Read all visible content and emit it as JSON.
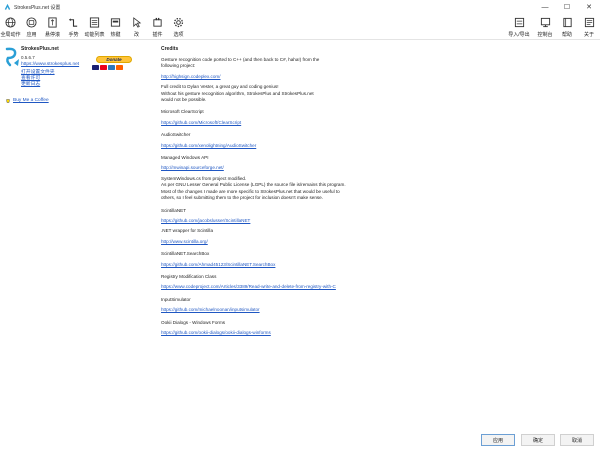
{
  "window": {
    "title": "StrokesPlus.net 设置",
    "min": "—",
    "max": "☐",
    "close": "✕"
  },
  "toolbar": {
    "left": [
      {
        "name": "global-actions",
        "label": "全局动作",
        "icon": "globe-icon"
      },
      {
        "name": "apps",
        "label": "应用",
        "icon": "app-window-icon"
      },
      {
        "name": "hover-scroll",
        "label": "悬停滚",
        "icon": "hover-scroll-icon"
      },
      {
        "name": "gestures",
        "label": "手势",
        "icon": "gesture-icon"
      },
      {
        "name": "gesture-list",
        "label": "动能列表",
        "icon": "list-icon"
      },
      {
        "name": "hotkeys",
        "label": "热键",
        "icon": "hotkey-icon"
      },
      {
        "name": "ignore",
        "label": "改",
        "icon": "cursor-icon"
      },
      {
        "name": "plugins",
        "label": "插件",
        "icon": "plugin-icon"
      },
      {
        "name": "options",
        "label": "选项",
        "icon": "gear-icon"
      }
    ],
    "right": [
      {
        "name": "import-export",
        "label": "导入/导出",
        "icon": "import-export-icon"
      },
      {
        "name": "console",
        "label": "控制台",
        "icon": "monitor-icon"
      },
      {
        "name": "help",
        "label": "帮助",
        "icon": "help-book-icon"
      },
      {
        "name": "about",
        "label": "关于",
        "icon": "about-icon"
      }
    ]
  },
  "about": {
    "app_name": "StrokesPlus.net",
    "version": "0.5.6.7",
    "website": "https://www.strokesplus.net",
    "open_settings_file": "打开设置文件夹",
    "view_license": "查看许可",
    "changelog": "更新日志",
    "donate_label": "Donate",
    "buy_coffee": "Buy Me a Coffee",
    "card_colors": [
      "#1a1f71",
      "#eb001b",
      "#2e77bb",
      "#ff6000"
    ]
  },
  "credits": {
    "title": "Credits",
    "lines": [
      "Gesture recognition code ported to C++ (and then back to C#, haha!) from the",
      "following project:",
      "http://highsign.codeplex.com/",
      "Full credit to Dylan Vester, a great guy and coding genius!",
      "Without his gesture recognition algorithm, StrokesPlus and StrokesPlus.net",
      "would not be possible.",
      "Microsoft ClearScript",
      "https://github.com/Microsoft/ClearScript",
      "AudioSwitcher",
      "https://github.com/xenolightning/AudioSwitcher",
      "Managed Windows API",
      "http://mwinapi.sourceforge.net/",
      "SystemWindows.cs from project modified.",
      "As per GNU Lesser General Public License (LGPL) the source file is/remains this program.",
      "Most of the changes I made are more specific to StrokesPlus.net that would be useful to",
      "others, so I feel submitting them to the project for inclusion doesn't make sense.",
      "ScintillaNET",
      "https://github.com/jacobslusser/ScintillaNET",
      ".NET wrapper for Scintilla",
      "http://www.scintilla.org/",
      "ScintillaNET.SearchBox",
      "https://github.com/Ahmad45123/ScintillaNET.SearchBox",
      "Registry Modification Class",
      "https://www.codeproject.com/Articles/3389/Read-write-and-delete-from-registry-with-C",
      "InputSimulator",
      "https://github.com/michaelnoonan/inputsimulator",
      "Ookii Dialogs - Windows Forms",
      "https://github.com/ookii-dialogs/ookii-dialogs-winforms"
    ]
  },
  "footer": {
    "apply": "应用",
    "ok": "确定",
    "cancel": "取消"
  }
}
